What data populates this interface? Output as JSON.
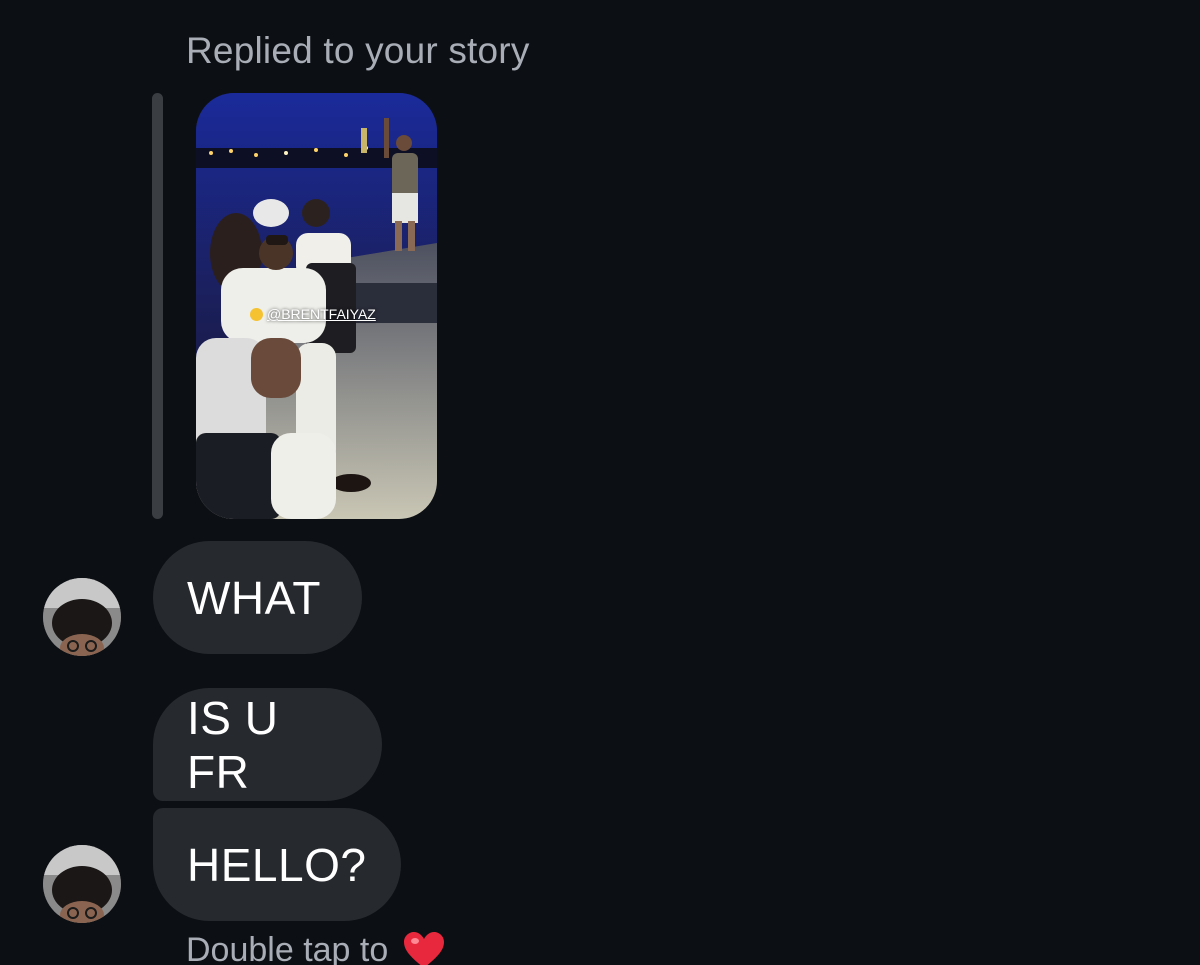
{
  "thread": {
    "reply_caption": "Replied to your story",
    "story": {
      "tag": "@BRENTFAIYAZ",
      "tag_emoji_icon": "hug-emoji-icon"
    },
    "messages": [
      {
        "text": "WHAT",
        "show_avatar": true
      },
      {
        "text": "IS U FR",
        "show_avatar": false
      },
      {
        "text": "HELLO?",
        "show_avatar": true
      }
    ],
    "double_tap_hint": "Double tap to",
    "double_tap_icon": "heart-icon"
  },
  "colors": {
    "background": "#0c0f13",
    "bubble": "#26292e",
    "secondary_text": "#a8adb6",
    "heart": "#e8283c"
  }
}
